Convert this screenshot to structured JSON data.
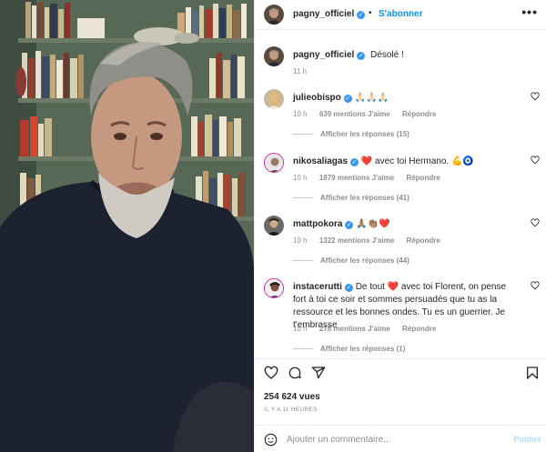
{
  "post": {
    "username": "pagny_officiel",
    "follow_label": "S'abonner",
    "more_label": "•••",
    "caption": "Désolé !",
    "caption_time": "11 h"
  },
  "comments": [
    {
      "username": "julieobispo",
      "text": "🙏🏻🙏🏻🙏🏻",
      "time": "10 h",
      "likes": "639 mentions J'aime",
      "reply": "Répondre",
      "replies": "Afficher les réponses (15)"
    },
    {
      "username": "nikosaliagas",
      "text": "❤️ avec toi Hermano. 💪🧿",
      "time": "10 h",
      "likes": "1879 mentions J'aime",
      "reply": "Répondre",
      "replies": "Afficher les réponses (41)"
    },
    {
      "username": "mattpokora",
      "text": "🙏🏽👏🏽❤️",
      "time": "10 h",
      "likes": "1322 mentions J'aime",
      "reply": "Répondre",
      "replies": "Afficher les réponses (44)"
    },
    {
      "username": "instacerutti",
      "text": "De tout ❤️ avec toi Florent, on pense fort à toi ce soir et sommes persuadés que tu as la ressource et les bonnes ondes. Tu es un guerrier. Je t'embrasse",
      "time": "10 h",
      "likes": "278 mentions J'aime",
      "reply": "Répondre",
      "replies": "Afficher les réponses (1)"
    }
  ],
  "footer": {
    "views": "254 624 vues",
    "time_ago": "IL Y A 11 HEURES",
    "comment_placeholder": "Ajouter un commentaire...",
    "publish_label": "Publier"
  },
  "colors": {
    "accent": "#0095f6",
    "verified": "#3897f0",
    "like_red": "#ed4956"
  }
}
